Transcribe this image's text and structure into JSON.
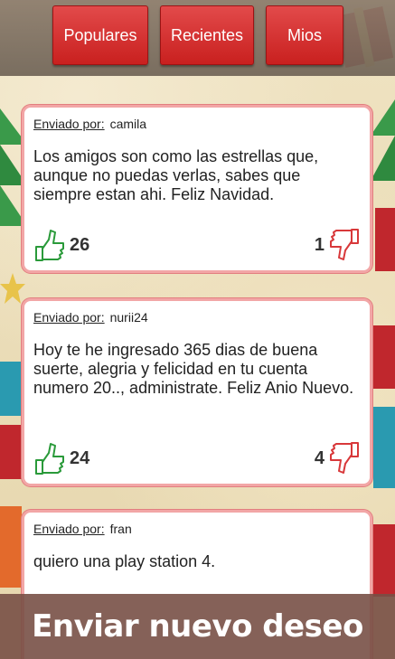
{
  "tabs": [
    {
      "label": "Populares"
    },
    {
      "label": "Recientes"
    },
    {
      "label": "Mios"
    }
  ],
  "posts": [
    {
      "sender_label": "Enviado por:",
      "sender": "camila",
      "message": "Los amigos son como las estrellas que, aunque no puedas verlas, sabes que siempre estan ahi. Feliz Navidad.",
      "likes": "26",
      "dislikes": "1"
    },
    {
      "sender_label": "Enviado por:",
      "sender": "nurii24",
      "message": "Hoy te he ingresado 365 dias de buena suerte, alegria y felicidad en tu cuenta numero 20.., administrate. Feliz Anio Nuevo.",
      "likes": "24",
      "dislikes": "4"
    },
    {
      "sender_label": "Enviado por:",
      "sender": "fran",
      "message": "quiero una play station 4.",
      "likes": "",
      "dislikes": ""
    }
  ],
  "submit_label": "Enviar nuevo deseo",
  "colors": {
    "tab": "#d0302f",
    "card_border": "#f2a6a6",
    "thumb_up": "#2a9a3a",
    "thumb_down": "#d8383a",
    "footer": "#785046"
  },
  "icons": {
    "like": "thumbs-up-icon",
    "dislike": "thumbs-down-icon"
  }
}
